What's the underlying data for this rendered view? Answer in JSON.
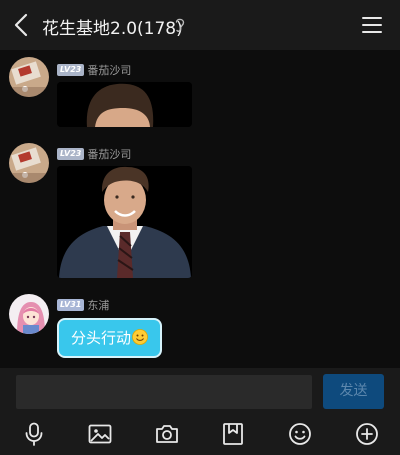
{
  "header": {
    "title": "花生基地2.0(178)",
    "back_icon": "chevron-left-icon",
    "ear_icon": "ear-icon",
    "menu_icon": "menu-icon"
  },
  "messages": [
    {
      "level": "LV23",
      "nickname": "番茄沙司",
      "type": "image",
      "image": "portrait-photo-cropped"
    },
    {
      "level": "LV23",
      "nickname": "番茄沙司",
      "type": "image",
      "image": "portrait-photo"
    },
    {
      "level": "LV31",
      "nickname": "东浦",
      "type": "text",
      "text": "分头行动",
      "emoji": "smiling-face-emoji"
    }
  ],
  "composer": {
    "input_value": "",
    "send_label": "发送"
  },
  "toolbar": {
    "icons": [
      "microphone-icon",
      "image-icon",
      "camera-icon",
      "bookmark-icon",
      "emoji-icon",
      "plus-circle-icon"
    ]
  },
  "colors": {
    "bubble": "#39c7ec",
    "send_button": "#0e4a7d",
    "background": "#0d0d0d",
    "bar": "#1a1a1a"
  }
}
